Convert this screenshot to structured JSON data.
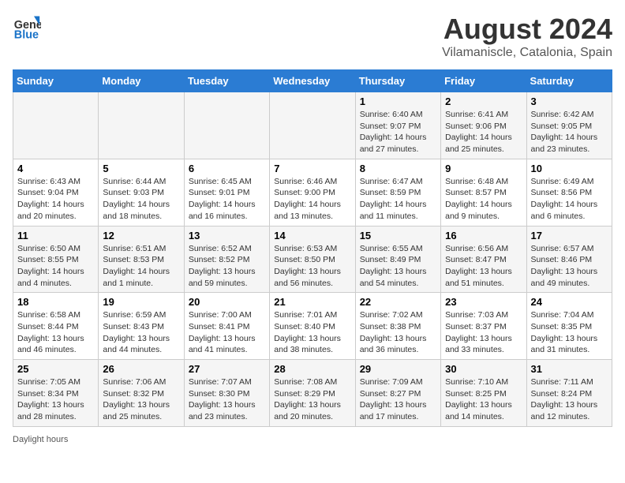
{
  "header": {
    "logo_line1": "General",
    "logo_line2": "Blue",
    "title": "August 2024",
    "subtitle": "Vilamaniscle, Catalonia, Spain"
  },
  "days_of_week": [
    "Sunday",
    "Monday",
    "Tuesday",
    "Wednesday",
    "Thursday",
    "Friday",
    "Saturday"
  ],
  "weeks": [
    [
      {
        "day": "",
        "info": ""
      },
      {
        "day": "",
        "info": ""
      },
      {
        "day": "",
        "info": ""
      },
      {
        "day": "",
        "info": ""
      },
      {
        "day": "1",
        "info": "Sunrise: 6:40 AM\nSunset: 9:07 PM\nDaylight: 14 hours and 27 minutes."
      },
      {
        "day": "2",
        "info": "Sunrise: 6:41 AM\nSunset: 9:06 PM\nDaylight: 14 hours and 25 minutes."
      },
      {
        "day": "3",
        "info": "Sunrise: 6:42 AM\nSunset: 9:05 PM\nDaylight: 14 hours and 23 minutes."
      }
    ],
    [
      {
        "day": "4",
        "info": "Sunrise: 6:43 AM\nSunset: 9:04 PM\nDaylight: 14 hours and 20 minutes."
      },
      {
        "day": "5",
        "info": "Sunrise: 6:44 AM\nSunset: 9:03 PM\nDaylight: 14 hours and 18 minutes."
      },
      {
        "day": "6",
        "info": "Sunrise: 6:45 AM\nSunset: 9:01 PM\nDaylight: 14 hours and 16 minutes."
      },
      {
        "day": "7",
        "info": "Sunrise: 6:46 AM\nSunset: 9:00 PM\nDaylight: 14 hours and 13 minutes."
      },
      {
        "day": "8",
        "info": "Sunrise: 6:47 AM\nSunset: 8:59 PM\nDaylight: 14 hours and 11 minutes."
      },
      {
        "day": "9",
        "info": "Sunrise: 6:48 AM\nSunset: 8:57 PM\nDaylight: 14 hours and 9 minutes."
      },
      {
        "day": "10",
        "info": "Sunrise: 6:49 AM\nSunset: 8:56 PM\nDaylight: 14 hours and 6 minutes."
      }
    ],
    [
      {
        "day": "11",
        "info": "Sunrise: 6:50 AM\nSunset: 8:55 PM\nDaylight: 14 hours and 4 minutes."
      },
      {
        "day": "12",
        "info": "Sunrise: 6:51 AM\nSunset: 8:53 PM\nDaylight: 14 hours and 1 minute."
      },
      {
        "day": "13",
        "info": "Sunrise: 6:52 AM\nSunset: 8:52 PM\nDaylight: 13 hours and 59 minutes."
      },
      {
        "day": "14",
        "info": "Sunrise: 6:53 AM\nSunset: 8:50 PM\nDaylight: 13 hours and 56 minutes."
      },
      {
        "day": "15",
        "info": "Sunrise: 6:55 AM\nSunset: 8:49 PM\nDaylight: 13 hours and 54 minutes."
      },
      {
        "day": "16",
        "info": "Sunrise: 6:56 AM\nSunset: 8:47 PM\nDaylight: 13 hours and 51 minutes."
      },
      {
        "day": "17",
        "info": "Sunrise: 6:57 AM\nSunset: 8:46 PM\nDaylight: 13 hours and 49 minutes."
      }
    ],
    [
      {
        "day": "18",
        "info": "Sunrise: 6:58 AM\nSunset: 8:44 PM\nDaylight: 13 hours and 46 minutes."
      },
      {
        "day": "19",
        "info": "Sunrise: 6:59 AM\nSunset: 8:43 PM\nDaylight: 13 hours and 44 minutes."
      },
      {
        "day": "20",
        "info": "Sunrise: 7:00 AM\nSunset: 8:41 PM\nDaylight: 13 hours and 41 minutes."
      },
      {
        "day": "21",
        "info": "Sunrise: 7:01 AM\nSunset: 8:40 PM\nDaylight: 13 hours and 38 minutes."
      },
      {
        "day": "22",
        "info": "Sunrise: 7:02 AM\nSunset: 8:38 PM\nDaylight: 13 hours and 36 minutes."
      },
      {
        "day": "23",
        "info": "Sunrise: 7:03 AM\nSunset: 8:37 PM\nDaylight: 13 hours and 33 minutes."
      },
      {
        "day": "24",
        "info": "Sunrise: 7:04 AM\nSunset: 8:35 PM\nDaylight: 13 hours and 31 minutes."
      }
    ],
    [
      {
        "day": "25",
        "info": "Sunrise: 7:05 AM\nSunset: 8:34 PM\nDaylight: 13 hours and 28 minutes."
      },
      {
        "day": "26",
        "info": "Sunrise: 7:06 AM\nSunset: 8:32 PM\nDaylight: 13 hours and 25 minutes."
      },
      {
        "day": "27",
        "info": "Sunrise: 7:07 AM\nSunset: 8:30 PM\nDaylight: 13 hours and 23 minutes."
      },
      {
        "day": "28",
        "info": "Sunrise: 7:08 AM\nSunset: 8:29 PM\nDaylight: 13 hours and 20 minutes."
      },
      {
        "day": "29",
        "info": "Sunrise: 7:09 AM\nSunset: 8:27 PM\nDaylight: 13 hours and 17 minutes."
      },
      {
        "day": "30",
        "info": "Sunrise: 7:10 AM\nSunset: 8:25 PM\nDaylight: 13 hours and 14 minutes."
      },
      {
        "day": "31",
        "info": "Sunrise: 7:11 AM\nSunset: 8:24 PM\nDaylight: 13 hours and 12 minutes."
      }
    ]
  ],
  "footer": {
    "daylight_label": "Daylight hours"
  }
}
